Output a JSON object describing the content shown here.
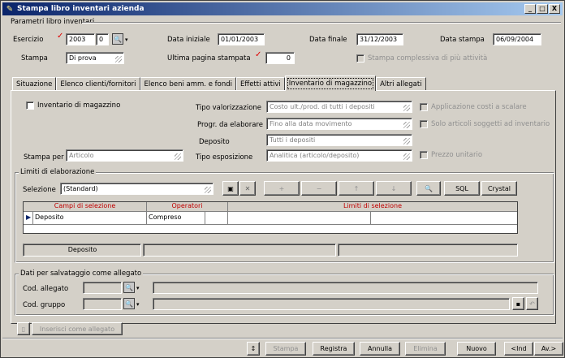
{
  "window": {
    "title": "Stampa libro inventari azienda",
    "controls": [
      "_",
      "□",
      "X"
    ]
  },
  "params": {
    "group_title": "Parametri libro inventari",
    "esercizio_label": "Esercizio",
    "esercizio_value": "2003",
    "esercizio_sub": "0",
    "stampa_label": "Stampa",
    "stampa_value": "Di prova",
    "data_iniziale_label": "Data iniziale",
    "data_iniziale_value": "01/01/2003",
    "ultima_pagina_label": "Ultima pagina stampata",
    "ultima_pagina_value": "0",
    "data_finale_label": "Data finale",
    "data_finale_value": "31/12/2003",
    "data_stampa_label": "Data stampa",
    "data_stampa_value": "06/09/2004",
    "stampa_complessiva_label": "Stampa complessiva di più attività"
  },
  "tabs": [
    {
      "label": "Situazione",
      "active": false
    },
    {
      "label": "Elenco clienti/fornitori",
      "active": false
    },
    {
      "label": "Elenco beni amm. e fondi",
      "active": false
    },
    {
      "label": "Effetti attivi",
      "active": false
    },
    {
      "label": "Inventario di magazzino",
      "active": true
    },
    {
      "label": "Altri allegati",
      "active": false
    }
  ],
  "inventario": {
    "checkbox_label": "Inventario di magazzino",
    "tipo_valorizzazione_label": "Tipo valorizzazione",
    "tipo_valorizzazione_value": "Costo ult./prod. di tutti i depositi",
    "progr_label": "Progr. da elaborare",
    "progr_value": "Fino alla data movimento",
    "deposito_label": "Deposito",
    "deposito_value": "Tutti i depositi",
    "tipo_esposizione_label": "Tipo esposizione",
    "tipo_esposizione_value": "Analitica (articolo/deposito)",
    "stampa_per_label": "Stampa per",
    "stampa_per_value": "Articolo",
    "applicazione_label": "Applicazione costi a scalare",
    "solo_articoli_label": "Solo articoli soggetti ad inventario",
    "prezzo_unitario_label": "Prezzo unitario"
  },
  "limiti": {
    "group_title": "Limiti di elaborazione",
    "selezione_label": "Selezione",
    "selezione_value": "(Standard)",
    "buttons": {
      "plus": "+",
      "minus": "−",
      "up": "↑",
      "down": "↓",
      "sql": "SQL",
      "crystal": "Crystal",
      "close": "✕"
    },
    "grid_headers": [
      "Campi di selezione",
      "Operatori",
      "Limiti di selezione"
    ],
    "grid_rows": [
      {
        "campo": "Deposito",
        "operatore": "Compreso",
        "limite": ""
      }
    ],
    "footer_label": "Deposito"
  },
  "allegato": {
    "group_title": "Dati per salvataggio come allegato",
    "cod_allegato_label": "Cod. allegato",
    "cod_gruppo_label": "Cod. gruppo",
    "inserisci_label": "Inserisci come allegato"
  },
  "bottom": {
    "sort_icon": "↕",
    "stampa": "Stampa",
    "registra": "Registra",
    "annulla": "Annulla",
    "elimina": "Elimina",
    "nuovo": "Nuovo",
    "ind": "<Ind",
    "av": "Av.>"
  }
}
